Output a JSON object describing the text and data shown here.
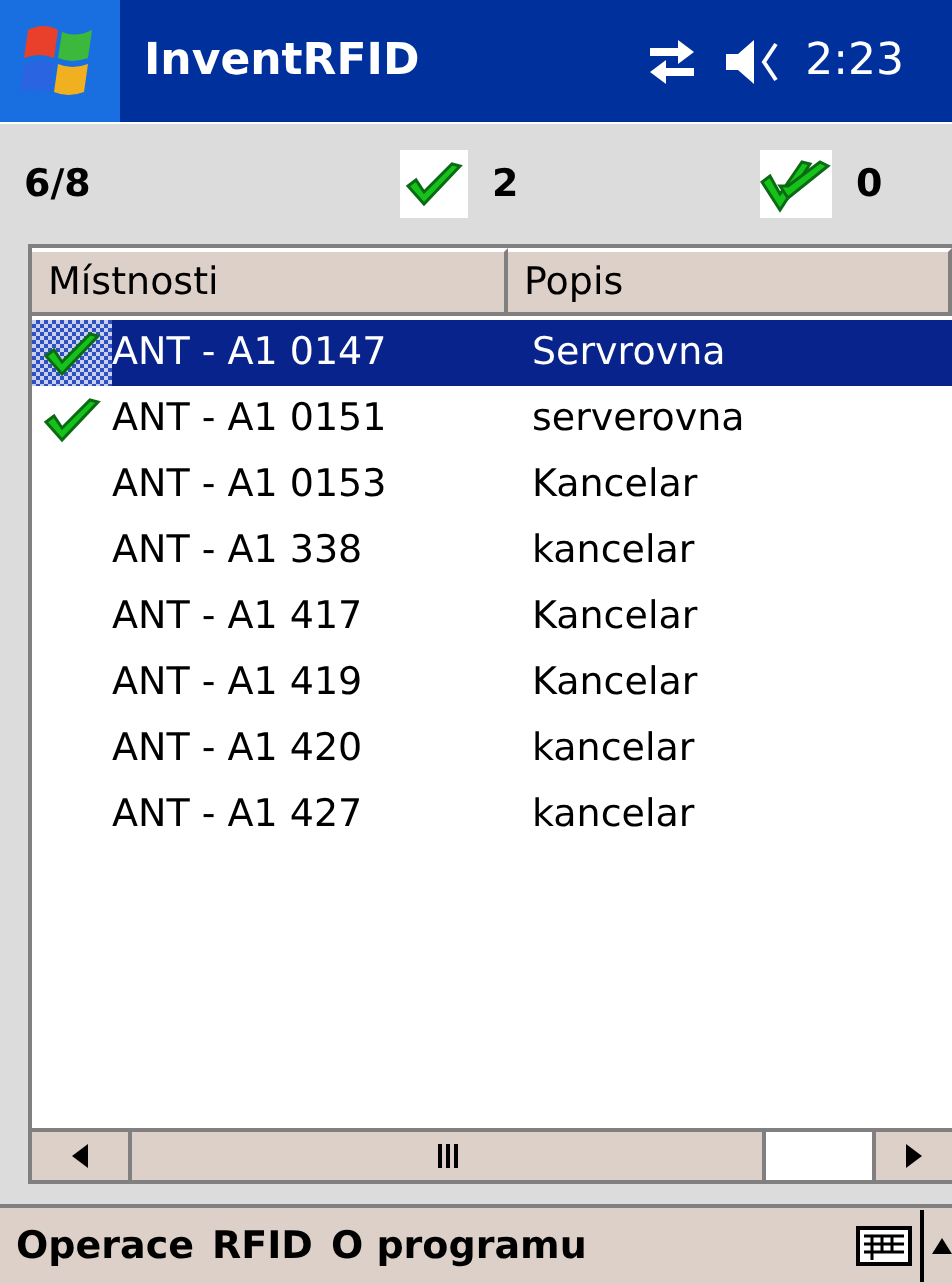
{
  "title_bar": {
    "title": "InventRFID",
    "time": "2:23"
  },
  "summary": {
    "progress": "6/8",
    "checked_count": "2",
    "double_checked_count": "0"
  },
  "table": {
    "columns": [
      "Místnosti",
      "Popis"
    ],
    "rows": [
      {
        "room": "ANT - A1 0147",
        "description": "Servrovna",
        "checked": true,
        "selected": true
      },
      {
        "room": "ANT - A1 0151",
        "description": "serverovna",
        "checked": true,
        "selected": false
      },
      {
        "room": "ANT - A1 0153",
        "description": "Kancelar",
        "checked": false,
        "selected": false
      },
      {
        "room": "ANT - A1 338",
        "description": "kancelar",
        "checked": false,
        "selected": false
      },
      {
        "room": "ANT - A1 417",
        "description": "Kancelar",
        "checked": false,
        "selected": false
      },
      {
        "room": "ANT - A1 419",
        "description": "Kancelar",
        "checked": false,
        "selected": false
      },
      {
        "room": "ANT - A1 420",
        "description": "kancelar",
        "checked": false,
        "selected": false
      },
      {
        "room": "ANT - A1 427",
        "description": "kancelar",
        "checked": false,
        "selected": false
      }
    ]
  },
  "menu_bar": [
    "Operace",
    "RFID",
    "O programu"
  ]
}
